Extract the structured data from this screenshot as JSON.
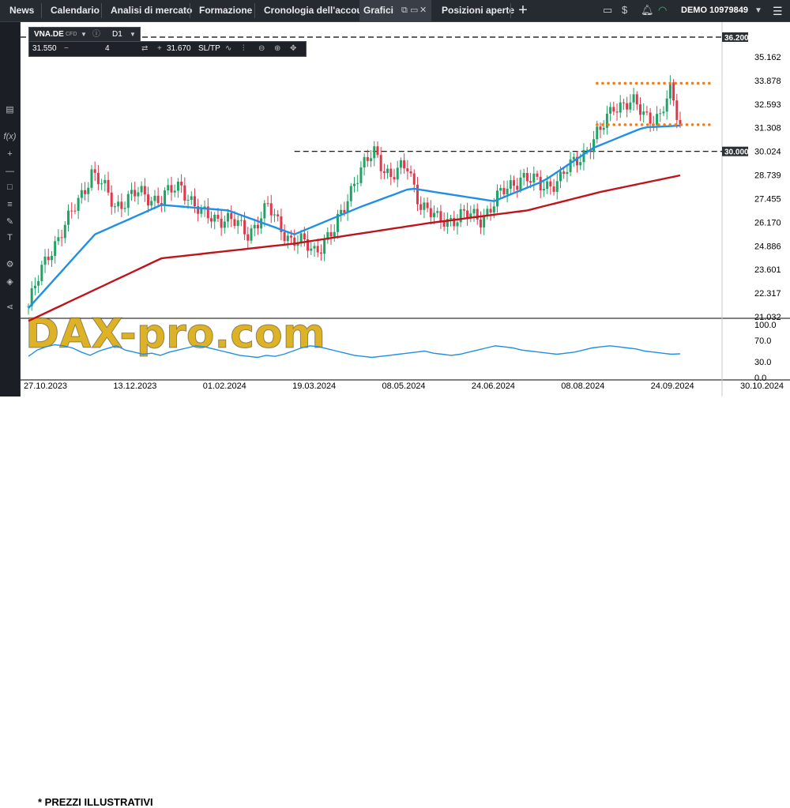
{
  "topbar": {
    "nav": [
      {
        "label": "News"
      },
      {
        "label": "Calendario"
      },
      {
        "label": "Analisi di mercato"
      },
      {
        "label": "Formazione"
      },
      {
        "label": "Cronologia dell'account"
      },
      {
        "label": "Grafici"
      },
      {
        "label": "Posizioni aperte"
      }
    ],
    "account": "DEMO  10979849"
  },
  "chart_header": {
    "symbol": "VNA.DE",
    "instrument_type": "CFD",
    "timeframe": "D1",
    "bid": "31.550",
    "volume": "4",
    "ask": "31.670",
    "sltp": "SL/TP"
  },
  "watermark": "DAX-pro.com",
  "footnote": "* PREZZI ILLUSTRATIVI",
  "colors": {
    "candle_up": "#21a366",
    "candle_down": "#e0374a",
    "ma_short": "#1f8fe5",
    "ma_long": "#c0141b",
    "levels": "#f07d1b",
    "rsi": "#1f8fe5",
    "watermark": "#d8a400",
    "dashed": "#000000"
  },
  "chart_data": {
    "type": "candlestick",
    "instrument": "VNA.DE",
    "timeframe": "D1",
    "price_axis": {
      "ylim": [
        21.032,
        36.2
      ],
      "ticks": [
        "35.162",
        "33.878",
        "32.593",
        "31.308",
        "30.024",
        "28.739",
        "27.455",
        "26.170",
        "24.886",
        "23.601",
        "22.317",
        "21.032"
      ]
    },
    "x_ticks": [
      "27.10.2023",
      "13.12.2023",
      "01.02.2024",
      "19.03.2024",
      "08.05.2024",
      "24.06.2024",
      "08.08.2024",
      "24.09.2024",
      "30.10.2024"
    ],
    "price_labels": [
      "36.200",
      "30.000"
    ],
    "horizontal_levels": [
      {
        "price": 36.2,
        "style": "dashed",
        "label": "36.200"
      },
      {
        "price": 30.0,
        "style": "dashed",
        "label": "30.000"
      }
    ],
    "range_lines": [
      {
        "price": 33.7,
        "style": "dotted",
        "color": "orange"
      },
      {
        "price": 31.45,
        "style": "dotted",
        "color": "orange"
      }
    ],
    "close_path": [
      [
        0,
        21.6
      ],
      [
        6,
        24.5
      ],
      [
        12,
        26.2
      ],
      [
        19,
        28.9
      ],
      [
        26,
        27.1
      ],
      [
        33,
        27.7
      ],
      [
        40,
        27.4
      ],
      [
        46,
        28.2
      ],
      [
        52,
        26.5
      ],
      [
        59,
        26.4
      ],
      [
        66,
        25.6
      ],
      [
        72,
        26.9
      ],
      [
        79,
        25.2
      ],
      [
        86,
        24.7
      ],
      [
        92,
        25.6
      ],
      [
        98,
        28.5
      ],
      [
        104,
        29.9
      ],
      [
        109,
        28.7
      ],
      [
        114,
        29.1
      ],
      [
        118,
        27.2
      ],
      [
        123,
        26.2
      ],
      [
        130,
        26.5
      ],
      [
        136,
        26.4
      ],
      [
        142,
        27.6
      ],
      [
        148,
        28.7
      ],
      [
        154,
        28.1
      ],
      [
        160,
        28.5
      ],
      [
        166,
        29.8
      ],
      [
        172,
        31.0
      ],
      [
        176,
        32.6
      ],
      [
        182,
        32.5
      ],
      [
        186,
        32.0
      ],
      [
        190,
        31.8
      ],
      [
        193,
        33.2
      ],
      [
        196,
        31.6
      ]
    ],
    "ma_short_path": [
      [
        0,
        21.5
      ],
      [
        20,
        25.5
      ],
      [
        40,
        27.1
      ],
      [
        60,
        26.8
      ],
      [
        80,
        25.5
      ],
      [
        100,
        27.0
      ],
      [
        115,
        28.0
      ],
      [
        140,
        27.3
      ],
      [
        155,
        28.4
      ],
      [
        170,
        30.2
      ],
      [
        185,
        31.3
      ],
      [
        196,
        31.4
      ]
    ],
    "ma_long_path": [
      [
        0,
        20.8
      ],
      [
        40,
        24.2
      ],
      [
        80,
        25.0
      ],
      [
        120,
        26.1
      ],
      [
        150,
        26.8
      ],
      [
        172,
        27.8
      ],
      [
        196,
        28.7
      ]
    ],
    "rsi": {
      "period": 14,
      "value": 44.7,
      "ylim": [
        0,
        100
      ],
      "ticks": [
        "100.0",
        "70.0",
        "30.0",
        "0.0"
      ],
      "series": [
        40,
        52,
        58,
        62,
        60,
        56,
        48,
        42,
        50,
        55,
        60,
        52,
        48,
        44,
        46,
        42,
        48,
        52,
        56,
        60,
        58,
        54,
        50,
        46,
        42,
        40,
        38,
        42,
        40,
        44,
        50,
        56,
        60,
        58,
        54,
        50,
        46,
        42,
        40,
        38,
        40,
        42,
        44,
        46,
        48,
        50,
        46,
        44,
        42,
        44,
        48,
        52,
        56,
        60,
        58,
        56,
        52,
        50,
        48,
        46,
        44,
        46,
        48,
        52,
        56,
        58,
        60,
        58,
        56,
        54,
        50,
        48,
        46,
        44,
        45
      ]
    }
  }
}
